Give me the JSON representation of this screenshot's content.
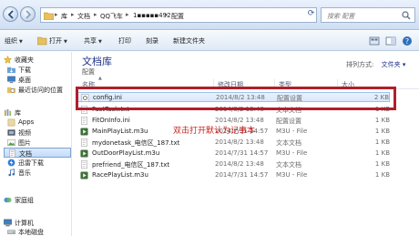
{
  "address": {
    "crumbs": [
      "库",
      "文档",
      "QQ飞车",
      "1▪▪▪▪▪492",
      "配置"
    ],
    "search_placeholder": "搜索 配置"
  },
  "toolbar": {
    "organize": "组织",
    "open": "打开",
    "share": "共享",
    "print": "打印",
    "burn": "刻录",
    "new_folder": "新建文件夹"
  },
  "sidebar": {
    "favorites": {
      "label": "收藏夹",
      "items": [
        "下载",
        "桌面",
        "最近访问的位置"
      ]
    },
    "libraries": {
      "label": "库",
      "items": [
        "Apps",
        "视频",
        "图片",
        "文档",
        "迅雷下载",
        "音乐"
      ]
    },
    "homegroup": "家庭组",
    "computer": {
      "label": "计算机",
      "items": [
        "本地磁盘"
      ]
    }
  },
  "library": {
    "title": "文档库",
    "subtitle": "配置",
    "arrange_label": "排列方式:",
    "arrange_value": "文件夹 ▾"
  },
  "columns": {
    "name": "名称",
    "date": "修改日期",
    "type": "类型",
    "size": "大小"
  },
  "files": [
    {
      "name": "config.ini",
      "date": "2014/8/2 13:48",
      "type": "配置设置",
      "size": "2 KB",
      "icon": "ini-gear-icon"
    },
    {
      "name": "FastTask.txt",
      "date": "2014/8/2 13:48",
      "type": "文本文档",
      "size": "1 KB",
      "icon": "text-file-icon"
    },
    {
      "name": "FitOnInfo.ini",
      "date": "2014/8/2 13:48",
      "type": "配置设置",
      "size": "1 KB",
      "icon": "ini-file-icon"
    },
    {
      "name": "MainPlayList.m3u",
      "date": "2014/7/31 14:57",
      "type": "M3U - File",
      "size": "1 KB",
      "icon": "m3u-file-icon"
    },
    {
      "name": "mydonetask_电信区_187.txt",
      "date": "2014/8/2 13:48",
      "type": "文本文档",
      "size": "1 KB",
      "icon": "text-file-icon"
    },
    {
      "name": "OutDoorPlayList.m3u",
      "date": "2014/7/31 14:57",
      "type": "M3U - File",
      "size": "1 KB",
      "icon": "m3u-file-icon"
    },
    {
      "name": "prefriend_电信区_187.txt",
      "date": "2014/8/2 13:48",
      "type": "文本文档",
      "size": "1 KB",
      "icon": "text-file-icon"
    },
    {
      "name": "RacePlayList.m3u",
      "date": "2014/7/31 14:57",
      "type": "M3U - File",
      "size": "1 KB",
      "icon": "m3u-file-icon"
    }
  ],
  "annotation": "双击打开默认为记事本",
  "colors": {
    "annotation_red": "#c9211e",
    "highlight_border": "#b01f2b",
    "title_blue": "#1e3287"
  }
}
